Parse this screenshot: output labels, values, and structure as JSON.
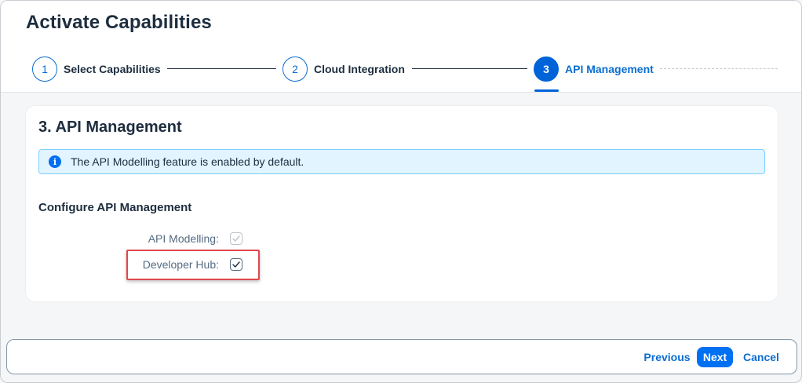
{
  "header": {
    "title": "Activate Capabilities",
    "steps": [
      {
        "number": "1",
        "label": "Select Capabilities"
      },
      {
        "number": "2",
        "label": "Cloud Integration"
      },
      {
        "number": "3",
        "label": "API Management"
      }
    ]
  },
  "section": {
    "title": "3. API Management",
    "info_message": "The API Modelling feature is enabled by default.",
    "info_icon": "i",
    "subtitle": "Configure API Management",
    "fields": [
      {
        "label": "API Modelling:",
        "checked": true,
        "disabled": true
      },
      {
        "label": "Developer Hub:",
        "checked": true,
        "disabled": false
      }
    ]
  },
  "footer": {
    "previous_label": "Previous",
    "next_label": "Next",
    "cancel_label": "Cancel"
  },
  "colors": {
    "accent": "#0070f2",
    "active_step": "#0064d9",
    "info_background": "#e1f4ff",
    "highlight": "#e0474c"
  }
}
